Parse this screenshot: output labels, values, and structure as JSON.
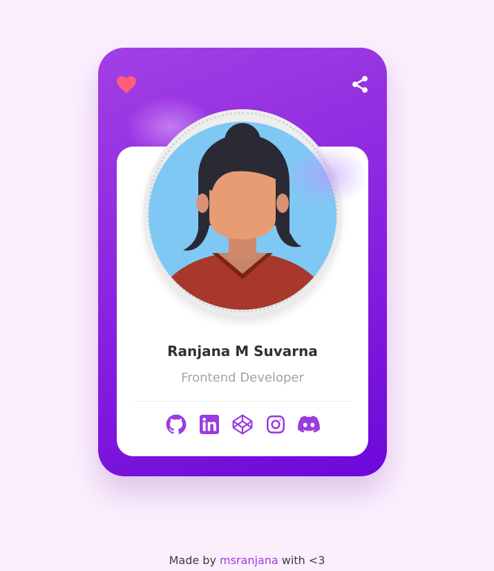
{
  "profile": {
    "name": "Ranjana M Suvarna",
    "role": "Frontend Developer"
  },
  "actions": {
    "like_icon": "heart-icon",
    "share_icon": "share-icon"
  },
  "social_links": [
    {
      "icon": "github-icon"
    },
    {
      "icon": "linkedin-icon"
    },
    {
      "icon": "codepen-icon"
    },
    {
      "icon": "instagram-icon"
    },
    {
      "icon": "discord-icon"
    }
  ],
  "footer": {
    "prefix": "Made by",
    "author": "msranjana",
    "suffix": "with <3"
  },
  "colors": {
    "background": "#fbeefd",
    "card_gradient_start": "#a240e4",
    "card_gradient_end": "#6d08d9",
    "heart": "#ff5e7a",
    "accent": "#9a3ce0",
    "name_text": "#2f2f3a",
    "role_text": "#a3a3ab"
  }
}
